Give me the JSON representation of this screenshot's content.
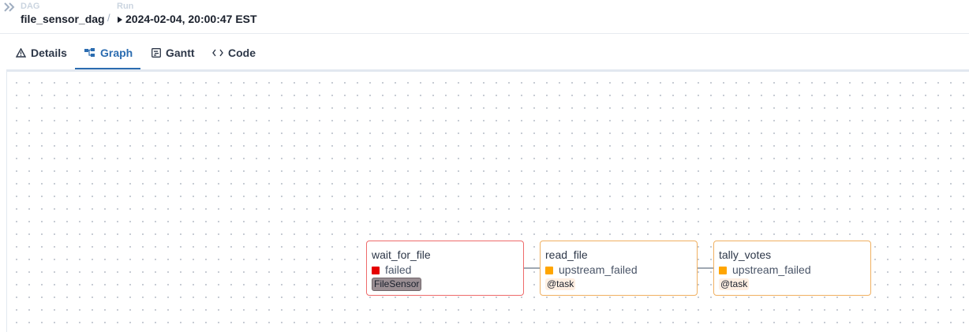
{
  "breadcrumb": {
    "dag_label": "DAG",
    "dag_id": "file_sensor_dag",
    "separator": "/",
    "run_label": "Run",
    "run_id": "2024-02-04, 20:00:47 EST"
  },
  "tabs": [
    {
      "label": "Details",
      "icon": "warning-icon"
    },
    {
      "label": "Graph",
      "icon": "graph-icon",
      "active": true
    },
    {
      "label": "Gantt",
      "icon": "gantt-icon"
    },
    {
      "label": "Code",
      "icon": "code-icon"
    }
  ],
  "nodes": [
    {
      "task_id": "wait_for_file",
      "state": "failed",
      "state_color": "#e50000",
      "operator": "FileSensor"
    },
    {
      "task_id": "read_file",
      "state": "upstream_failed",
      "state_color": "#ffa500",
      "operator": "@task"
    },
    {
      "task_id": "tally_votes",
      "state": "upstream_failed",
      "state_color": "#ffa500",
      "operator": "@task"
    }
  ]
}
